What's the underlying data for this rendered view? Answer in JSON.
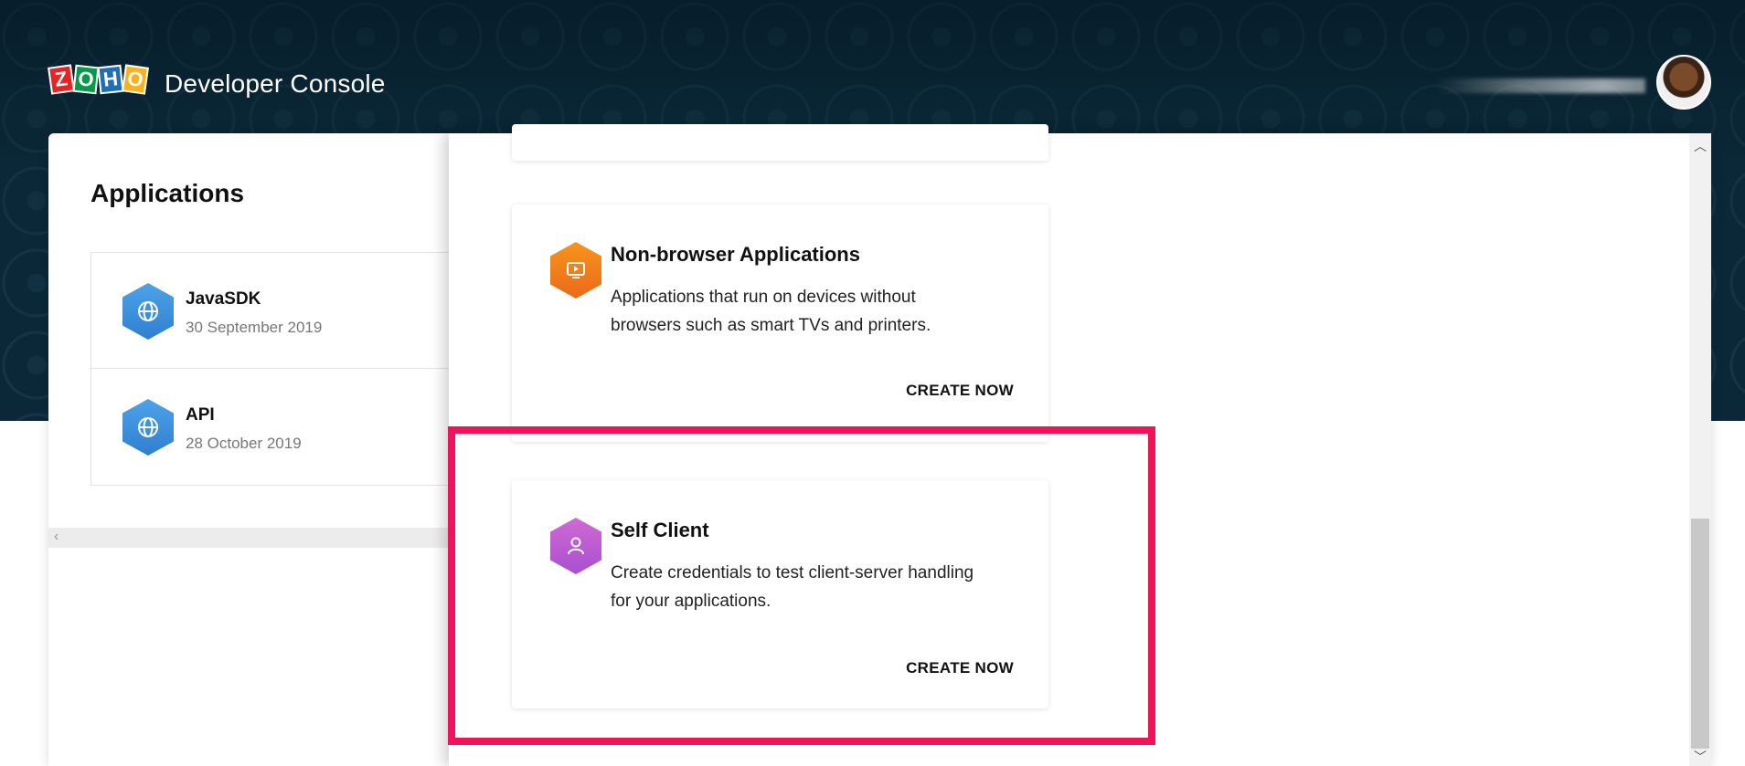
{
  "header": {
    "logo_letters": [
      "Z",
      "O",
      "H",
      "O"
    ],
    "title": "Developer Console"
  },
  "applications": {
    "heading": "Applications",
    "items": [
      {
        "name": "JavaSDK",
        "date": "30 September 2019",
        "icon": "globe-icon"
      },
      {
        "name": "API",
        "date": "28 October 2019",
        "icon": "globe-icon"
      }
    ]
  },
  "client_types": {
    "cards": [
      {
        "title": "Non-browser Applications",
        "description": "Applications that run on devices without browsers such as smart TVs and printers.",
        "action": "CREATE NOW",
        "icon": "monitor-icon",
        "icon_color": "#f7941d"
      },
      {
        "title": "Self Client",
        "description": "Create credentials to test client-server handling for your applications.",
        "action": "CREATE NOW",
        "icon": "user-icon",
        "icon_color": "#c65fd3"
      }
    ]
  },
  "colors": {
    "header_bg": "#0b2838",
    "highlight": "#f0125a",
    "app_icon": "#3d8fdc"
  }
}
